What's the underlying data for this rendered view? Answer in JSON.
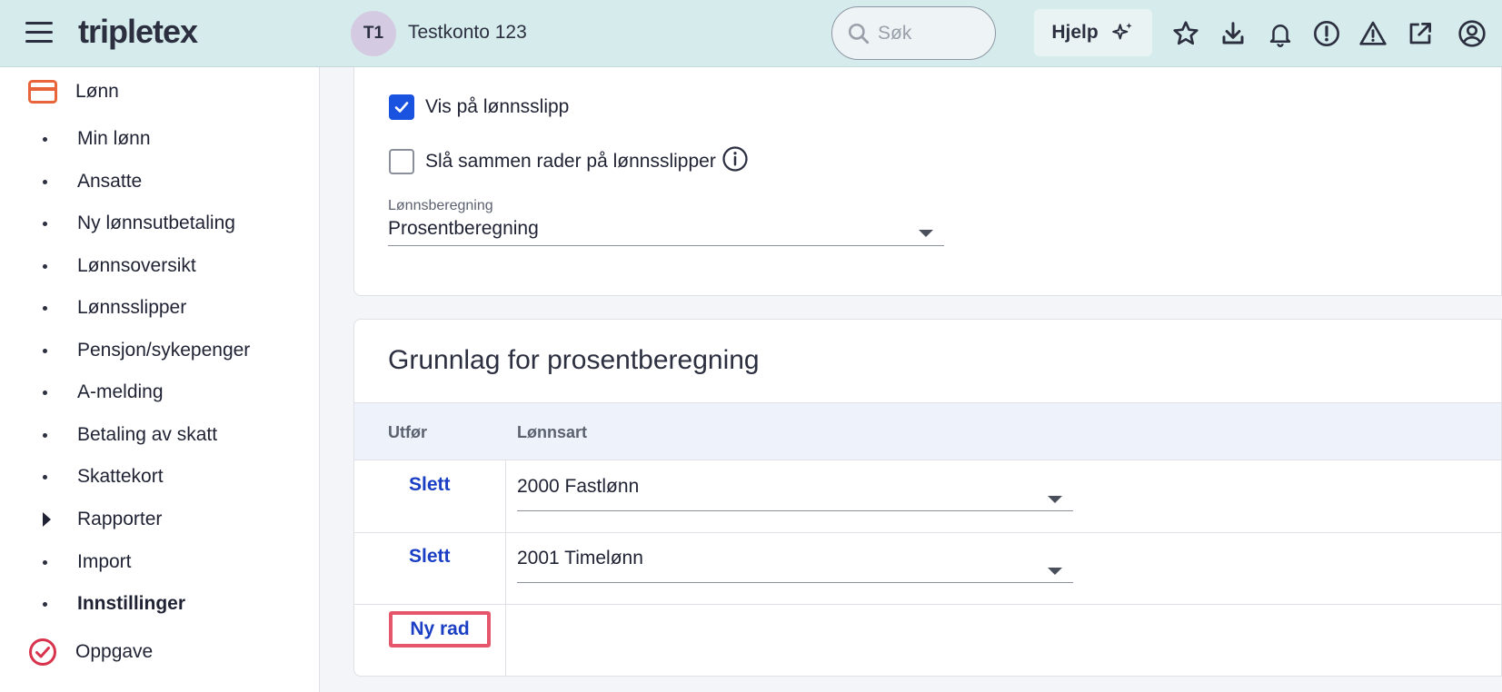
{
  "header": {
    "logo_text": "tripletex",
    "account_initials": "T1",
    "account_name": "Testkonto 123",
    "search_placeholder": "Søk",
    "help_label": "Hjelp",
    "icons": [
      "star-icon",
      "download-icon",
      "bell-icon",
      "alert-circle-icon",
      "warning-icon",
      "external-link-icon",
      "user-circle-icon"
    ]
  },
  "sidebar": {
    "section_top": {
      "label": "Lønn",
      "icon": "card-icon"
    },
    "items": [
      {
        "label": "Min lønn"
      },
      {
        "label": "Ansatte"
      },
      {
        "label": "Ny lønnsutbetaling"
      },
      {
        "label": "Lønnsoversikt"
      },
      {
        "label": "Lønnsslipper"
      },
      {
        "label": "Pensjon/sykepenger"
      },
      {
        "label": "A-melding"
      },
      {
        "label": "Betaling av skatt"
      },
      {
        "label": "Skattekort"
      },
      {
        "label": "Rapporter",
        "expandable": true
      },
      {
        "label": "Import"
      },
      {
        "label": "Innstillinger",
        "active": true
      }
    ],
    "section_bottom": {
      "label": "Oppgave",
      "icon": "check-circle-icon"
    }
  },
  "settings": {
    "show_on_payslip_label": "Vis på lønnsslipp",
    "show_on_payslip_checked": true,
    "merge_rows_label": "Slå sammen rader på lønnsslipper",
    "merge_rows_checked": false,
    "calc_label": "Lønnsberegning",
    "calc_value": "Prosentberegning"
  },
  "basis": {
    "title": "Grunnlag for prosentberegning",
    "col_action": "Utfør",
    "col_wage_type": "Lønnsart",
    "rows": [
      {
        "action": "Slett",
        "wage_type": "2000 Fastlønn"
      },
      {
        "action": "Slett",
        "wage_type": "2001 Timelønn"
      }
    ],
    "new_row_label": "Ny rad"
  },
  "colors": {
    "header_bg": "#d6ecec",
    "link_blue": "#1a3fc4",
    "checkbox_blue": "#1a53e0",
    "highlight_red": "#e5566b",
    "lonn_icon_orange": "#e8643a",
    "oppgave_icon_red": "#d8334d"
  }
}
